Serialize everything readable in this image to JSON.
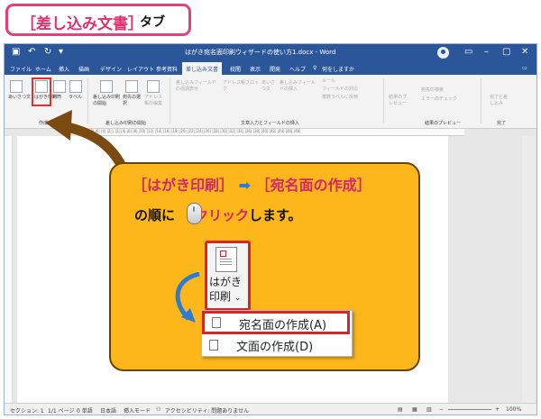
{
  "heading": {
    "title": "［差し込み文書］",
    "subtitle": "タブ"
  },
  "window": {
    "title": "はがき宛名面印刷ウィザードの使い方1.docx - Word"
  },
  "menu": {
    "items": [
      "ファイル",
      "ホーム",
      "挿入",
      "描画",
      "デザイン",
      "レイアウト",
      "参考資料",
      "差し込み文書",
      "校閲",
      "表示",
      "開発",
      "ヘルプ"
    ],
    "search": "何をしますか"
  },
  "ribbon": {
    "create_items": [
      "あいさつ文",
      "はがき印刷",
      "封筒",
      "ラベル"
    ],
    "group_create": "作成",
    "merge_start": [
      "差し込み印刷の開始",
      "宛先の選択",
      "アドレス帳の編集"
    ],
    "group_merge_start": "差し込み印刷の開始",
    "fields": [
      "差し込みフィールドの強調表示",
      "アドレス帳ブロック",
      "あいさつ文",
      "差し込みフィールドの挿入"
    ],
    "rules": [
      "ルール",
      "フィールドの対応",
      "複数ラベルに反映"
    ],
    "group_fields": "文章入力とフィールドの挿入",
    "preview": [
      "結果のプレビュー",
      "宛先の検索",
      "エラーのチェック"
    ],
    "group_preview": "結果のプレビュー",
    "finish": "完了と差し込み",
    "group_finish": "完了"
  },
  "ruler_numbers": "|8| |6| |4| |2| | |2| |4| |6| |8| |10| |12| |14| |16| |18| |20| |22| |24| |26| |28| |30| |32| |34| |36| |38| |40| |42| |44| |46| |48|",
  "callout": {
    "step1": "［はがき印刷］",
    "arrow": "➡",
    "step2": "［宛名面の作成］",
    "instr_pre": "の順に",
    "instr_click": "クリック",
    "instr_post": "します。",
    "button_label_1": "はがき",
    "button_label_2": "印刷",
    "button_chevron": "⌄",
    "dropdown_items": [
      "宛名面の作成(A)",
      "文面の作成(D)"
    ]
  },
  "status": {
    "section": "セクション: 1",
    "page": "1/1 ページ",
    "words": "0 単語",
    "lang": "日本語",
    "mode": "挿入モード",
    "accessibility": "アクセシビリティ: 問題ありません",
    "zoom": "100%"
  },
  "colors": {
    "accent": "#2b579a",
    "highlight": "#d42727",
    "callout": "#fdb71a",
    "pink": "#e0306e"
  }
}
